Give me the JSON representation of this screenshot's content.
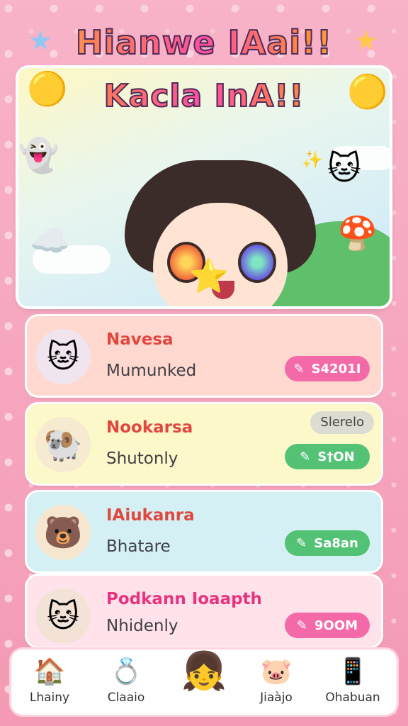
{
  "header": {
    "title_line1": "Hianwe IAai!!",
    "title_line2": "Kacla InA!!"
  },
  "cards": [
    {
      "name": "Navesa",
      "subtitle": "Mumunked",
      "button_label": "S4201I",
      "name_color": "#e0483f",
      "bg": "#ffd8cf",
      "pill_color": "#f46aa8",
      "avatar": "🐱"
    },
    {
      "name": "Nookarsa",
      "subtitle": "Shutonly",
      "button_label": "S†ON",
      "tag": "Slerelo",
      "name_color": "#e0483f",
      "bg": "#fdf8c9",
      "pill_color": "#53c274",
      "avatar": "🐏"
    },
    {
      "name": "IAiukanra",
      "subtitle": "Bhatare",
      "button_label": "Sa8an",
      "name_color": "#e0483f",
      "bg": "#d4f0f4",
      "pill_color": "#53c274",
      "avatar": "🐻"
    },
    {
      "name": "Podkann Ioaapth",
      "subtitle": "Nhidenly",
      "button_label": "9OOM",
      "name_color": "#e8347f",
      "bg": "#ffe2ea",
      "pill_color": "#f46aa8",
      "avatar": "🐱"
    }
  ],
  "tabs": [
    {
      "label": "Lhainy",
      "icon": "home-icon"
    },
    {
      "label": "Claaio",
      "icon": "ring-icon"
    },
    {
      "label": "",
      "icon": "avatar-icon"
    },
    {
      "label": "Jiaàjo",
      "icon": "pig-icon"
    },
    {
      "label": "Ohabuan",
      "icon": "device-icon"
    }
  ]
}
